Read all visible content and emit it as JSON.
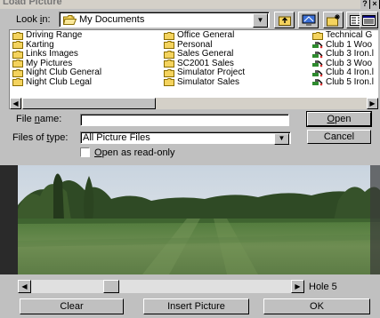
{
  "window": {
    "title": "Load Picture",
    "help_glyph": "?",
    "close_glyph": "×"
  },
  "look_in": {
    "label_pre": "Look ",
    "label_key": "i",
    "label_post": "n:",
    "value": "My Documents"
  },
  "toolbar": {
    "up_icon": "up-folder-icon",
    "desktop_icon": "desktop-icon",
    "new_folder_icon": "new-folder-icon",
    "list_view_icon": "list-view-icon",
    "details_view_icon": "details-view-icon"
  },
  "files": {
    "col1": [
      "Driving Range",
      "Karting",
      "Links Images",
      "My Pictures",
      "Night Club General",
      "Night Club Legal"
    ],
    "col2": [
      "Office General",
      "Personal",
      "Sales General",
      "SC2001 Sales",
      "Simulator Project",
      "Simulator Sales"
    ],
    "col3": [
      "Technical G",
      "Club 1 Woo",
      "Club 3 Iron.l",
      "Club 3 Woo",
      "Club 4 Iron.l",
      "Club 5 Iron.l"
    ]
  },
  "file_name": {
    "label_pre": "File ",
    "label_key": "n",
    "label_post": "ame:",
    "value": ""
  },
  "file_type": {
    "label_pre": "Files of ",
    "label_key": "t",
    "label_post": "ype:",
    "value": "All Picture Files"
  },
  "read_only": {
    "label_key": "O",
    "label_post": "pen as read-only",
    "checked": false
  },
  "buttons": {
    "open_key": "O",
    "open_post": "pen",
    "cancel": "Cancel",
    "clear": "Clear",
    "insert": "Insert Picture",
    "ok": "OK"
  },
  "hole_label": "Hole 5",
  "colors": {
    "dialog_bg": "#c0c0c0",
    "folder_yellow": "#f4d35e",
    "club_green": "#2e8b2e"
  }
}
